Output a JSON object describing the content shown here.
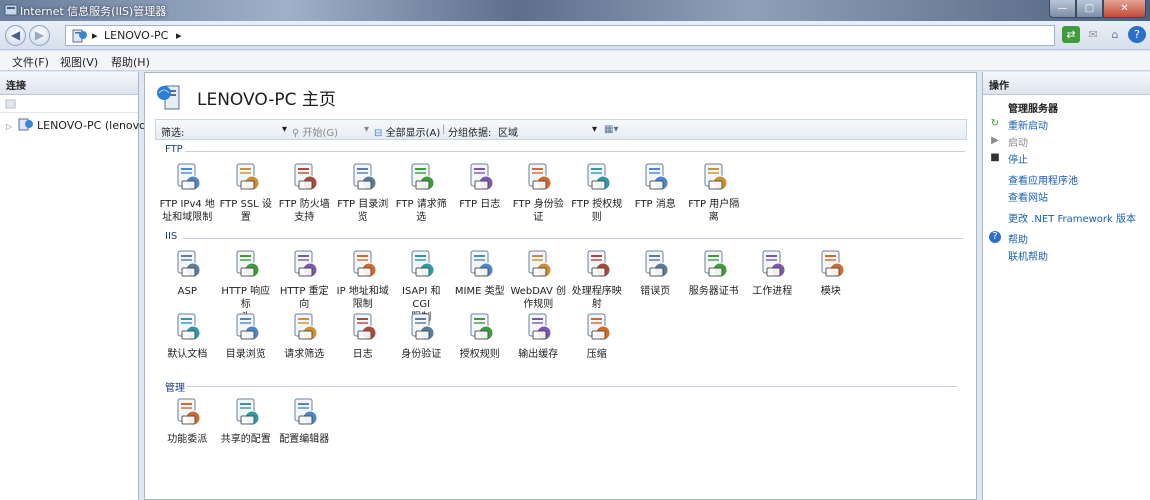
{
  "window": {
    "title": "Internet 信息服务(IIS)管理器",
    "buttons": {
      "min": "—",
      "max": "□",
      "close": "✕"
    }
  },
  "address": {
    "crumbs": [
      "▸",
      "LENOVO-PC",
      "▸"
    ]
  },
  "menu": [
    "文件(F)",
    "视图(V)",
    "帮助(H)"
  ],
  "left": {
    "title": "连接",
    "tree_item": "LENOVO-PC (lenovo"
  },
  "center": {
    "title": "LENOVO-PC 主页",
    "filter": {
      "label": "筛选:",
      "start": "开始(G)",
      "show_all": "全部显示(A)",
      "group_label": "分组依据:",
      "group_value": "区域"
    },
    "sections": [
      {
        "title": "FTP",
        "items": [
          {
            "l1": "FTP IPv4 地",
            "l2": "址和域限制",
            "icon": "ftp-ip-icon"
          },
          {
            "l1": "FTP SSL 设",
            "l2": "置",
            "icon": "ftp-ssl-icon"
          },
          {
            "l1": "FTP 防火墙",
            "l2": "支持",
            "icon": "ftp-firewall-icon"
          },
          {
            "l1": "FTP 目录浏",
            "l2": "览",
            "icon": "ftp-dir-icon"
          },
          {
            "l1": "FTP 请求筛",
            "l2": "选",
            "icon": "ftp-filter-icon"
          },
          {
            "l1": "FTP 日志",
            "l2": "",
            "icon": "ftp-log-icon"
          },
          {
            "l1": "FTP 身份验",
            "l2": "证",
            "icon": "ftp-auth-icon"
          },
          {
            "l1": "FTP 授权规",
            "l2": "则",
            "icon": "ftp-authz-icon"
          },
          {
            "l1": "FTP 消息",
            "l2": "",
            "icon": "ftp-message-icon"
          },
          {
            "l1": "FTP 用户隔",
            "l2": "离",
            "icon": "ftp-isolation-icon"
          }
        ]
      },
      {
        "title": "IIS",
        "items": [
          {
            "l1": "ASP",
            "l2": "",
            "icon": "asp-icon"
          },
          {
            "l1": "HTTP 响应标",
            "l2": "头",
            "icon": "http-headers-icon"
          },
          {
            "l1": "HTTP 重定向",
            "l2": "",
            "icon": "http-redirect-icon"
          },
          {
            "l1": "IP 地址和域",
            "l2": "限制",
            "icon": "ip-restrict-icon"
          },
          {
            "l1": "ISAPI 和 CGI",
            "l2": "限制",
            "icon": "isapi-icon"
          },
          {
            "l1": "MIME 类型",
            "l2": "",
            "icon": "mime-icon"
          },
          {
            "l1": "WebDAV 创",
            "l2": "作规则",
            "icon": "webdav-icon"
          },
          {
            "l1": "处理程序映",
            "l2": "射",
            "icon": "handler-icon"
          },
          {
            "l1": "错误页",
            "l2": "",
            "icon": "error-page-icon"
          },
          {
            "l1": "服务器证书",
            "l2": "",
            "icon": "certificate-icon"
          },
          {
            "l1": "工作进程",
            "l2": "",
            "icon": "worker-process-icon"
          },
          {
            "l1": "模块",
            "l2": "",
            "icon": "modules-icon"
          },
          {
            "l1": "默认文档",
            "l2": "",
            "icon": "default-doc-icon"
          },
          {
            "l1": "目录浏览",
            "l2": "",
            "icon": "dir-browse-icon"
          },
          {
            "l1": "请求筛选",
            "l2": "",
            "icon": "request-filter-icon"
          },
          {
            "l1": "日志",
            "l2": "",
            "icon": "logging-icon"
          },
          {
            "l1": "身份验证",
            "l2": "",
            "icon": "authentication-icon"
          },
          {
            "l1": "授权规则",
            "l2": "",
            "icon": "authorization-icon"
          },
          {
            "l1": "输出缓存",
            "l2": "",
            "icon": "output-cache-icon"
          },
          {
            "l1": "压缩",
            "l2": "",
            "icon": "compression-icon"
          }
        ]
      },
      {
        "title": "管理",
        "items": [
          {
            "l1": "功能委派",
            "l2": "",
            "icon": "feature-delegation-icon"
          },
          {
            "l1": "共享的配置",
            "l2": "",
            "icon": "shared-config-icon"
          },
          {
            "l1": "配置编辑器",
            "l2": "",
            "icon": "config-editor-icon"
          }
        ]
      }
    ]
  },
  "right": {
    "title": "操作",
    "group": "管理服务器",
    "actions": [
      "重新启动",
      "启动",
      "停止",
      "查看应用程序池",
      "查看网站",
      "更改 .NET Framework 版本",
      "帮助",
      "联机帮助"
    ]
  },
  "colors": {
    "link": "#1a5fb4",
    "section": "#1b3e8a",
    "disabled": "#8a8a8a"
  }
}
